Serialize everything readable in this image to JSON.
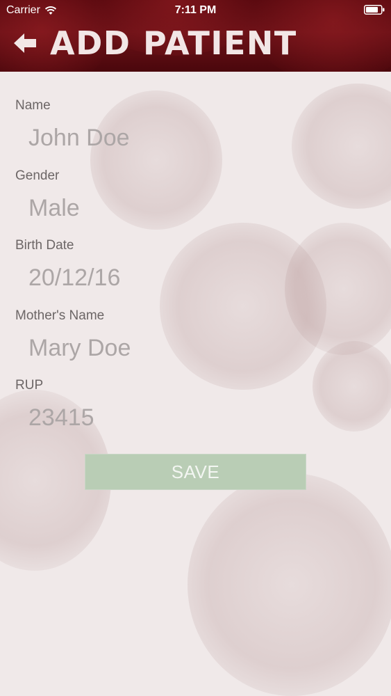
{
  "status_bar": {
    "carrier": "Carrier",
    "time": "7:11 PM",
    "wifi_icon": "wifi-icon",
    "battery_icon": "battery-icon"
  },
  "header": {
    "title": "ADD PATIENT",
    "back_icon": "arrow-left-icon"
  },
  "form": {
    "fields": [
      {
        "label": "Name",
        "value": "John Doe"
      },
      {
        "label": "Gender",
        "value": "Male"
      },
      {
        "label": "Birth Date",
        "value": "20/12/16"
      },
      {
        "label": "Mother's Name",
        "value": "Mary Doe"
      },
      {
        "label": "RUP",
        "value": "23415"
      }
    ],
    "save_label": "SAVE"
  },
  "colors": {
    "header_bg": "#6e1218",
    "save_button": "#b9cdb5",
    "label_text": "#6c6666",
    "value_text": "#aca6a6",
    "background": "#f0e9e9"
  }
}
